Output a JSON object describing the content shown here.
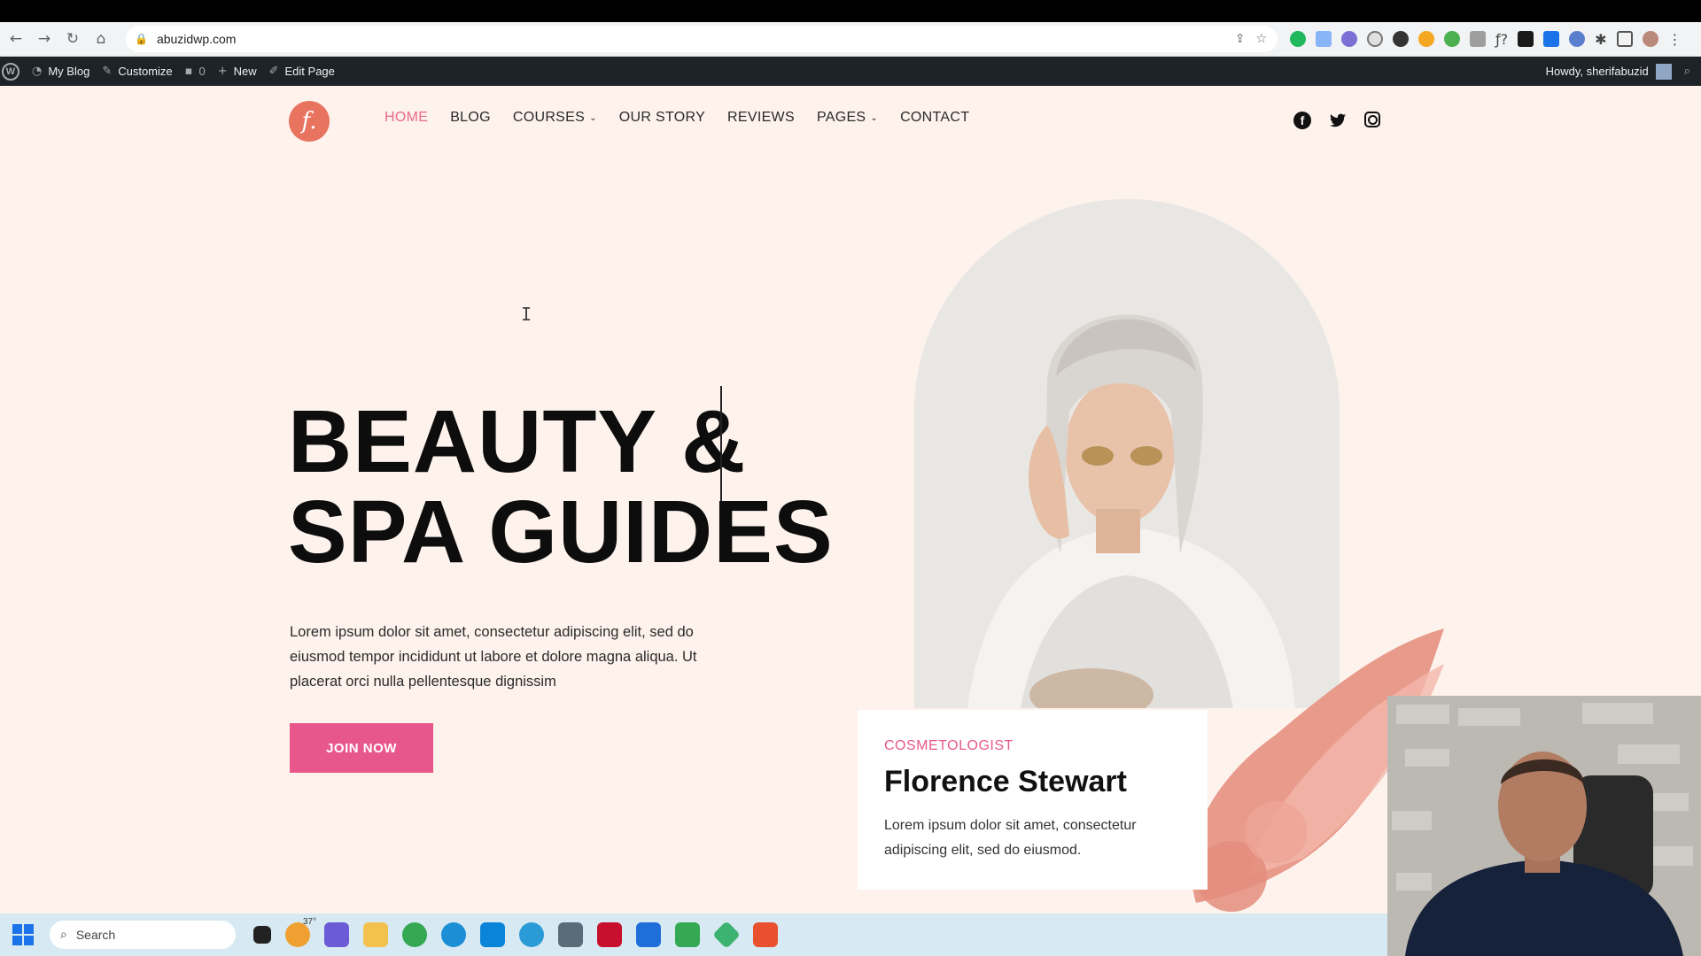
{
  "browser": {
    "url": "abuzidwp.com",
    "nav": {
      "back_icon": "←",
      "forward_icon": "→",
      "reload_icon": "↻",
      "home_icon": "⌂"
    }
  },
  "wp_admin_bar": {
    "site_name": "My Blog",
    "customize": "Customize",
    "comments_count": "0",
    "new": "New",
    "edit_page": "Edit Page",
    "greeting": "Howdy, sherifabuzid"
  },
  "site": {
    "logo_letter": "f.",
    "nav": [
      {
        "label": "HOME",
        "active": true,
        "dropdown": false
      },
      {
        "label": "BLOG",
        "active": false,
        "dropdown": false
      },
      {
        "label": "COURSES",
        "active": false,
        "dropdown": true
      },
      {
        "label": "OUR STORY",
        "active": false,
        "dropdown": false
      },
      {
        "label": "REVIEWS",
        "active": false,
        "dropdown": false
      },
      {
        "label": "PAGES",
        "active": false,
        "dropdown": true
      },
      {
        "label": "CONTACT",
        "active": false,
        "dropdown": false
      }
    ],
    "social": {
      "facebook": "f",
      "twitter": "🐦",
      "instagram": ""
    }
  },
  "hero": {
    "title_line1": "BEAUTY &",
    "title_line2": "SPA GUIDES",
    "description": "Lorem ipsum dolor sit amet, consectetur adipiscing elit, sed do eiusmod tempor incididunt ut labore et dolore magna aliqua. Ut placerat orci nulla pellentesque dignissim",
    "cta": "JOIN NOW"
  },
  "profile_card": {
    "role": "COSMETOLOGIST",
    "name": "Florence Stewart",
    "bio": "Lorem ipsum dolor sit amet, consectetur adipiscing elit, sed do eiusmod."
  },
  "taskbar": {
    "search_placeholder": "Search",
    "weather_temp": "37°"
  },
  "colors": {
    "accent_pink": "#e8578b",
    "logo_coral": "#e8745f",
    "page_bg": "#fdf2ec"
  }
}
